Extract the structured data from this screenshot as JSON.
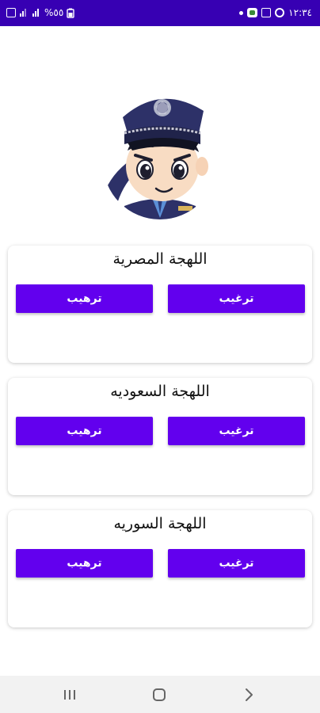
{
  "status_bar": {
    "left_text": "%٥٥",
    "time": "١٢:٣٤"
  },
  "sections": [
    {
      "title": "اللهجة المصرية",
      "encourage_label": "ترغيب",
      "intimidate_label": "ترهيب"
    },
    {
      "title": "اللهجة السعوديه",
      "encourage_label": "ترغيب",
      "intimidate_label": "ترهيب"
    },
    {
      "title": "اللهجة السوريه",
      "encourage_label": "ترغيب",
      "intimidate_label": "ترهيب"
    }
  ],
  "icons": {
    "avatar": "police-officer-avatar",
    "nav_recent": "recent-apps-icon",
    "nav_home": "home-icon",
    "nav_back": "back-icon"
  },
  "colors": {
    "status_bar": "#3700b3",
    "button": "#6200ee",
    "button_text": "#ffffff"
  }
}
